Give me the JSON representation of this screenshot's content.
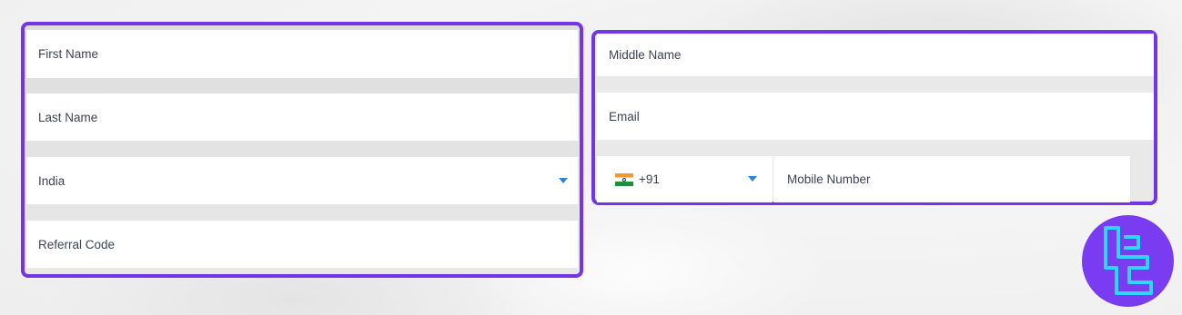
{
  "form": {
    "first_name": {
      "placeholder": "First Name"
    },
    "last_name": {
      "placeholder": "Last Name"
    },
    "country": {
      "value": "India"
    },
    "referral_code": {
      "placeholder": "Referral Code"
    },
    "middle_name": {
      "placeholder": "Middle Name"
    },
    "email": {
      "placeholder": "Email"
    },
    "phone_code": {
      "value": "+91",
      "flag": "india-flag-icon"
    },
    "mobile_number": {
      "placeholder": "Mobile Number"
    }
  },
  "colors": {
    "highlight_border": "#7434e8",
    "caret": "#2a86d3",
    "logo_bg": "#7a3cf0",
    "logo_stroke": "#2fd6ff"
  },
  "logo": {
    "icon": "tc-logo-icon"
  }
}
